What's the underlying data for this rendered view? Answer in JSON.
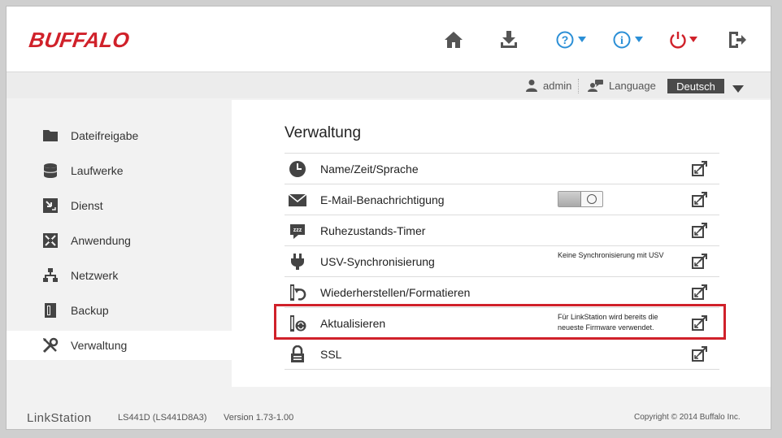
{
  "brand": {
    "logo_text": "BUFFALO",
    "accent": "#d0212a"
  },
  "header": {
    "icons": [
      "home-icon",
      "download-icon",
      "help-icon",
      "info-icon",
      "power-icon",
      "logout-icon"
    ]
  },
  "subbar": {
    "user": "admin",
    "language_label": "Language",
    "language_value": "Deutsch"
  },
  "sidebar": {
    "items": [
      {
        "label": "Dateifreigabe",
        "icon": "folder-icon"
      },
      {
        "label": "Laufwerke",
        "icon": "drive-icon"
      },
      {
        "label": "Dienst",
        "icon": "service-icon"
      },
      {
        "label": "Anwendung",
        "icon": "application-icon"
      },
      {
        "label": "Netzwerk",
        "icon": "network-icon"
      },
      {
        "label": "Backup",
        "icon": "backup-icon"
      },
      {
        "label": "Verwaltung",
        "icon": "tools-icon",
        "active": true
      }
    ]
  },
  "main": {
    "title": "Verwaltung",
    "rows": [
      {
        "label": "Name/Zeit/Sprache",
        "icon": "clock-icon",
        "note": ""
      },
      {
        "label": "E-Mail-Benachrichtigung",
        "icon": "mail-icon",
        "note": ""
      },
      {
        "label": "Ruhezustands-Timer",
        "icon": "sleep-timer-icon",
        "note": ""
      },
      {
        "label": "USV-Synchronisierung",
        "icon": "plug-icon",
        "note": "Keine Synchronisierung mit USV"
      },
      {
        "label": "Wiederherstellen/Formatieren",
        "icon": "restore-icon",
        "note": ""
      },
      {
        "label": "Aktualisieren",
        "icon": "update-icon",
        "note_line1": "Für LinkStation wird bereits die",
        "note_line2": "neueste Firmware verwendet."
      },
      {
        "label": "SSL",
        "icon": "lock-icon",
        "note": ""
      }
    ]
  },
  "footer": {
    "brand": "LinkStation",
    "model": "LS441D (LS441D8A3)",
    "version": "Version 1.73-1.00",
    "copyright": "Copyright © 2014 Buffalo Inc."
  }
}
